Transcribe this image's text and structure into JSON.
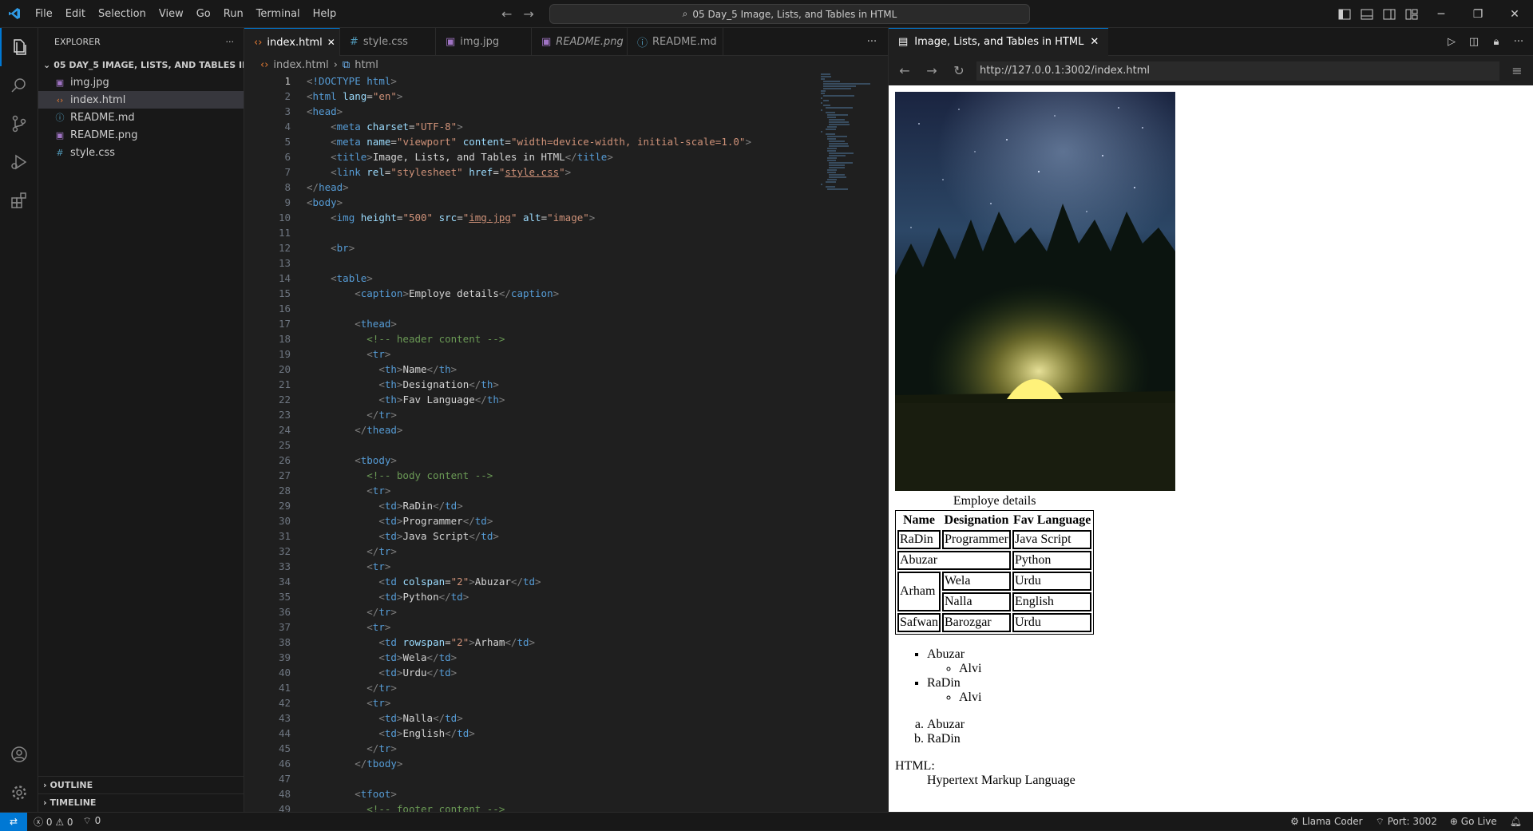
{
  "titlebar": {
    "menus": [
      "File",
      "Edit",
      "Selection",
      "View",
      "Go",
      "Run",
      "Terminal",
      "Help"
    ],
    "search_text": "05 Day_5 Image, Lists, and Tables in HTML"
  },
  "explorer": {
    "title": "EXPLORER",
    "folder": "05 DAY_5 IMAGE, LISTS, AND TABLES IN HT...",
    "files": [
      "img.jpg",
      "index.html",
      "README.md",
      "README.png",
      "style.css"
    ],
    "outline": "OUTLINE",
    "timeline": "TIMELINE"
  },
  "editor": {
    "tabs": [
      "index.html",
      "style.css",
      "img.jpg",
      "README.png",
      "README.md"
    ],
    "breadcrumb_file": "index.html",
    "breadcrumb_el": "html"
  },
  "code_lines": [
    "<!DOCTYPE html>",
    "<html lang=\"en\">",
    "<head>",
    "    <meta charset=\"UTF-8\">",
    "    <meta name=\"viewport\" content=\"width=device-width, initial-scale=1.0\">",
    "    <title>Image, Lists, and Tables in HTML</title>",
    "    <link rel=\"stylesheet\" href=\"style.css\">",
    "</head>",
    "<body>",
    "    <img height=\"500\" src=\"img.jpg\" alt=\"image\">",
    "",
    "    <br>",
    "",
    "    <table>",
    "        <caption>Employe details</caption>",
    "",
    "        <thead>",
    "          <!-- header content -->",
    "          <tr>",
    "            <th>Name</th>",
    "            <th>Designation</th>",
    "            <th>Fav Language</th>",
    "          </tr>",
    "        </thead>",
    "",
    "        <tbody>",
    "          <!-- body content -->",
    "          <tr>",
    "            <td>RaDin</td>",
    "            <td>Programmer</td>",
    "            <td>Java Script</td>",
    "          </tr>",
    "          <tr>",
    "            <td colspan=\"2\">Abuzar</td>",
    "            <td>Python</td>",
    "          </tr>",
    "          <tr>",
    "            <td rowspan=\"2\">Arham</td>",
    "            <td>Wela</td>",
    "            <td>Urdu</td>",
    "          </tr>",
    "          <tr>",
    "            <td>Nalla</td>",
    "            <td>English</td>",
    "          </tr>",
    "        </tbody>",
    "",
    "        <tfoot>",
    "          <!-- footer content -->"
  ],
  "preview": {
    "tab_title": "Image, Lists, and Tables in HTML",
    "url": "http://127.0.0.1:3002/index.html",
    "caption": "Employe details",
    "headers": [
      "Name",
      "Designation",
      "Fav Language"
    ],
    "r1": [
      "RaDin",
      "Programmer",
      "Java Script"
    ],
    "r2": [
      "Abuzar",
      "Python"
    ],
    "r3": [
      "Arham",
      "Wela",
      "Urdu"
    ],
    "r4": [
      "Nalla",
      "English"
    ],
    "r5": [
      "Safwan",
      "Barozgar",
      "Urdu"
    ],
    "ul": [
      {
        "item": "Abuzar",
        "sub": "Alvi"
      },
      {
        "item": "RaDin",
        "sub": "Alvi"
      }
    ],
    "ol": [
      "Abuzar",
      "RaDin"
    ],
    "dt": "HTML:",
    "dd": "Hypertext Markup Language"
  },
  "status": {
    "errors": "0",
    "warnings": "0",
    "ports": "0",
    "llama": "Llama Coder",
    "port": "Port: 3002",
    "golive": "Go Live"
  },
  "colors": {
    "accent": "#0078d4",
    "bg": "#1f1f1f"
  }
}
